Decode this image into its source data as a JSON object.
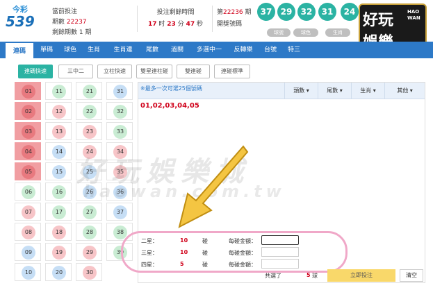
{
  "header": {
    "logo_top": "今彩",
    "logo_bottom": "539",
    "current_label": "當前投注",
    "period_label": "期數",
    "period_value": "22237",
    "remaining_periods": "剩餘期數 1 期",
    "time_title": "投注剩餘時間",
    "time_h": "17",
    "time_h_unit": "时",
    "time_m": "23",
    "time_m_unit": "分",
    "time_s": "47",
    "time_s_unit": "秒",
    "draw_prefix": "第",
    "draw_period": "22236",
    "draw_suffix": "期",
    "draw_label": "開獎號碼",
    "balls": [
      "37",
      "29",
      "32",
      "31",
      "24"
    ],
    "pills": [
      "球號",
      "球色",
      "生肖"
    ]
  },
  "brand": {
    "line1": "好玩",
    "line2": "娛樂",
    "en1": "HAO",
    "en2": "WAN"
  },
  "nav": [
    "連碼",
    "單碼",
    "球色",
    "生肖",
    "生肖連",
    "尾數",
    "過關",
    "多選中一",
    "反轉樂",
    "台號",
    "特三"
  ],
  "subnav": [
    "連碼快速",
    "三中二",
    "立柱快速",
    "雙星連柱碰",
    "雙連碰",
    "連碰標準"
  ],
  "numbers": [
    [
      "01",
      "11",
      "21",
      "31"
    ],
    [
      "02",
      "12",
      "22",
      "32"
    ],
    [
      "03",
      "13",
      "23",
      "33"
    ],
    [
      "04",
      "14",
      "24",
      "34"
    ],
    [
      "05",
      "15",
      "25",
      "35"
    ],
    [
      "06",
      "16",
      "26",
      "36"
    ],
    [
      "07",
      "17",
      "27",
      "37"
    ],
    [
      "08",
      "18",
      "28",
      "38"
    ],
    [
      "09",
      "19",
      "29",
      "39"
    ],
    [
      "10",
      "20",
      "30",
      ""
    ]
  ],
  "colors": {
    "red": "#f7c5c8",
    "blue": "#c6def5",
    "green": "#c9ecd3",
    "selected": "#f19ea2",
    "accent": "#2bb3a3",
    "nav": "#2d79c7"
  },
  "panel": {
    "hint": "※最多一次可選25個號碼",
    "columns": [
      "頭數 ▾",
      "尾數 ▾",
      "生肖 ▾",
      "其他 ▾"
    ],
    "picked": "01,02,03,04,05",
    "rows": [
      {
        "label": "二星：",
        "count": "10",
        "unit": "碰",
        "amount_label": "每碰金額："
      },
      {
        "label": "三星：",
        "count": "10",
        "unit": "碰",
        "amount_label": "每碰金額："
      },
      {
        "label": "四星：",
        "count": "5",
        "unit": "碰",
        "amount_label": "每碰金額："
      }
    ],
    "total_label": "共選了",
    "total_value": "5",
    "total_unit": "球",
    "submit": "立即投注",
    "clear": "清空"
  },
  "watermark": {
    "line1": "好玩娛樂城",
    "line2": "haowan.com.tw"
  }
}
